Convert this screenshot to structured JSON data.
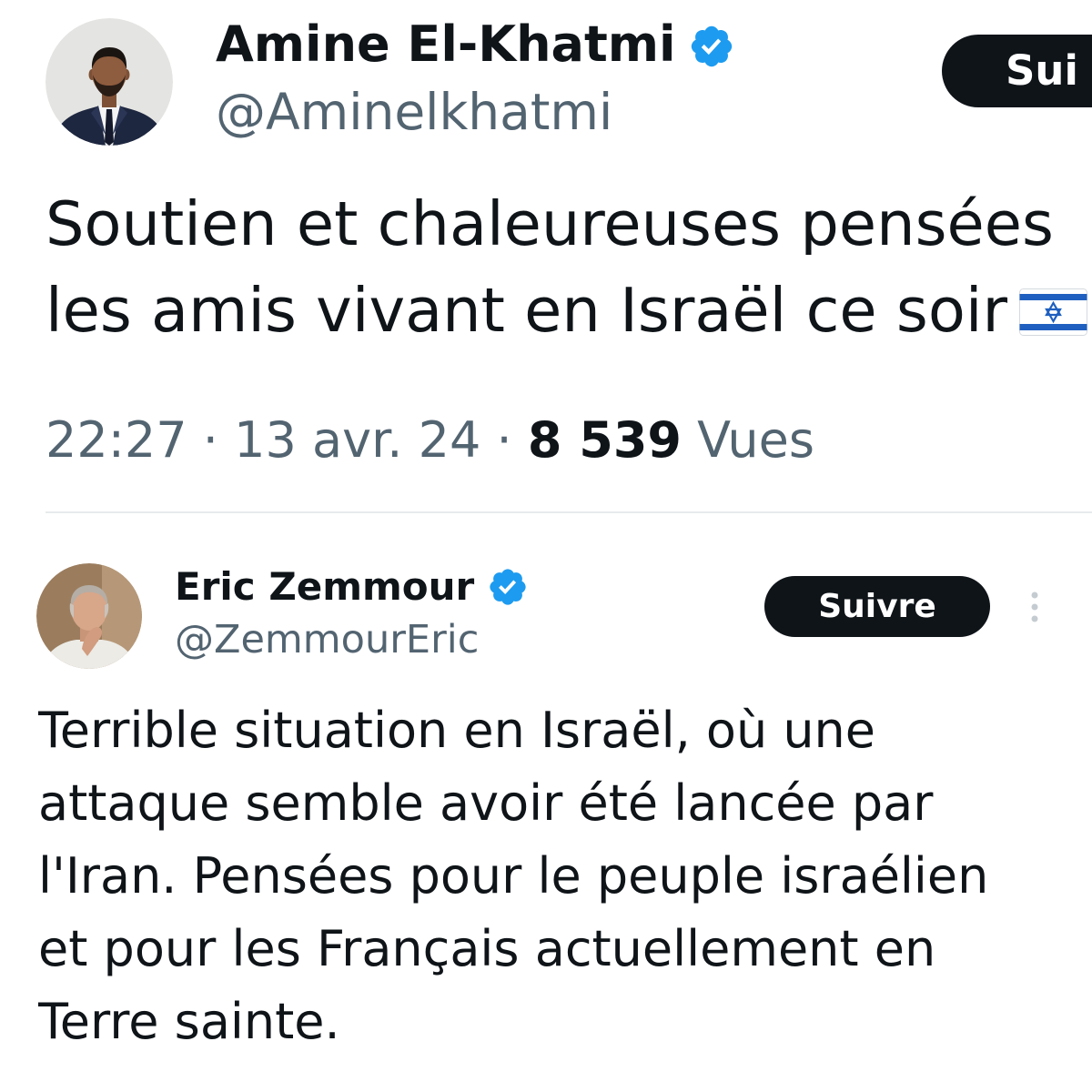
{
  "colors": {
    "text": "#0f1419",
    "secondary_text": "#536471",
    "verified_badge": "#1d9bf0",
    "follow_button_bg": "#0f1419",
    "follow_button_text": "#ffffff",
    "divider": "#e7eaec"
  },
  "tweets": [
    {
      "author": {
        "name": "Amine El-Khatmi",
        "handle": "@Aminelkhatmi",
        "avatar_icon": "profile-photo",
        "verified_icon": "verified-badge-icon"
      },
      "follow_button": {
        "label": "Sui"
      },
      "text_lines": [
        "Soutien et chaleureuses pensées",
        "les amis vivant en Israël ce soir"
      ],
      "emoji_icon": "israel-flag-icon",
      "meta": {
        "time": "22:27",
        "separator": "·",
        "date": "13 avr. 24",
        "views_count": "8 539",
        "views_label": "Vues"
      }
    },
    {
      "author": {
        "name": "Eric Zemmour",
        "handle": "@ZemmourEric",
        "avatar_icon": "profile-photo",
        "verified_icon": "verified-badge-icon"
      },
      "follow_button": {
        "label": "Suivre"
      },
      "menu_icon": "more-vertical-icon",
      "text_lines": [
        "Terrible situation en Israël, où une",
        "attaque semble avoir été lancée par",
        "l'Iran. Pensées pour le peuple israélien",
        "et pour les Français actuellement en",
        "Terre sainte."
      ]
    }
  ]
}
